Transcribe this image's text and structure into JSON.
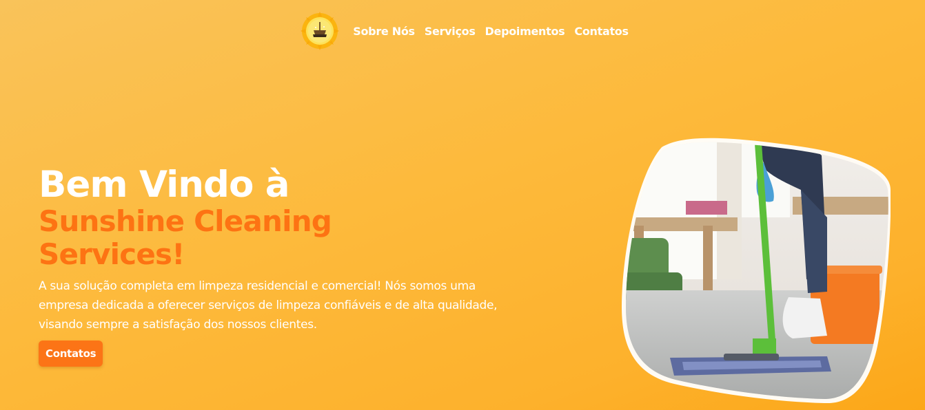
{
  "nav": {
    "logo_icon": "sun-broom-logo-icon",
    "links": [
      {
        "label": "Sobre Nós"
      },
      {
        "label": "Serviços"
      },
      {
        "label": "Depoimentos"
      },
      {
        "label": "Contatos"
      }
    ]
  },
  "hero": {
    "title_line1": "Bem Vindo à",
    "title_line2": "Sunshine Cleaning Services!",
    "description": "A sua solução completa em limpeza residencial e comercial! Nós somos uma empresa dedicada a oferecer serviços de limpeza confiáveis e de alta qualidade, visando sempre a satisfação dos nossos clientes.",
    "cta_label": "Contatos",
    "image_subject": "person-mopping-floor-photo"
  },
  "colors": {
    "background": "#fdba3c",
    "accent": "#fd7313",
    "text": "#ffffff"
  }
}
